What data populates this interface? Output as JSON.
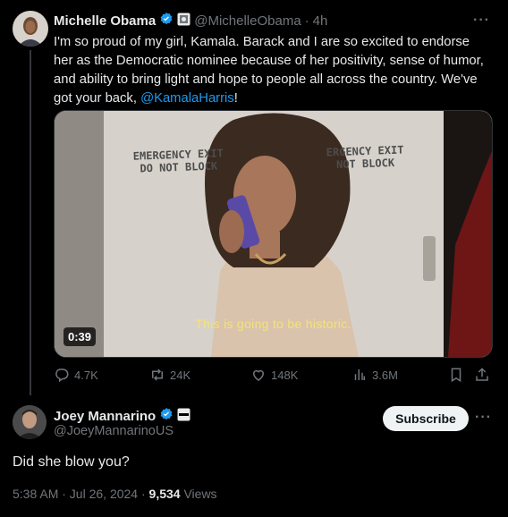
{
  "parent": {
    "name": "Michelle Obama",
    "handle": "@MichelleObama",
    "separator": "·",
    "time": "4h",
    "more": "···",
    "text_prefix": "I'm so proud of my girl, Kamala. Barack and I are so excited to endorse her as the Democratic nominee because of her positivity, sense of humor, and ability to bring light and hope to people all across the country. We've got your back, ",
    "mention": "@KamalaHarris",
    "text_suffix": "!",
    "media": {
      "sign_left_line1": "EMERGENCY EXIT",
      "sign_left_line2": "DO NOT BLOCK",
      "sign_right_line1": "ERGENCY EXIT",
      "sign_right_line2": "NOT BLOCK",
      "caption": "This is going to be historic.",
      "duration": "0:39"
    },
    "actions": {
      "replies": "4.7K",
      "reposts": "24K",
      "likes": "148K",
      "views": "3.6M"
    }
  },
  "reply": {
    "name": "Joey Mannarino",
    "handle": "@JoeyMannarinoUS",
    "subscribe_label": "Subscribe",
    "more": "···",
    "text": "Did she blow you?",
    "time": "5:38 AM · Jul 26, 2024 · ",
    "view_count": "9,534",
    "views_label": " Views"
  },
  "colors": {
    "background": "#000000",
    "text": "#e7e9ea",
    "muted": "#71767b",
    "link": "#1d9bf0",
    "verified": "#1d9bf0",
    "caption": "#f3e27a"
  }
}
